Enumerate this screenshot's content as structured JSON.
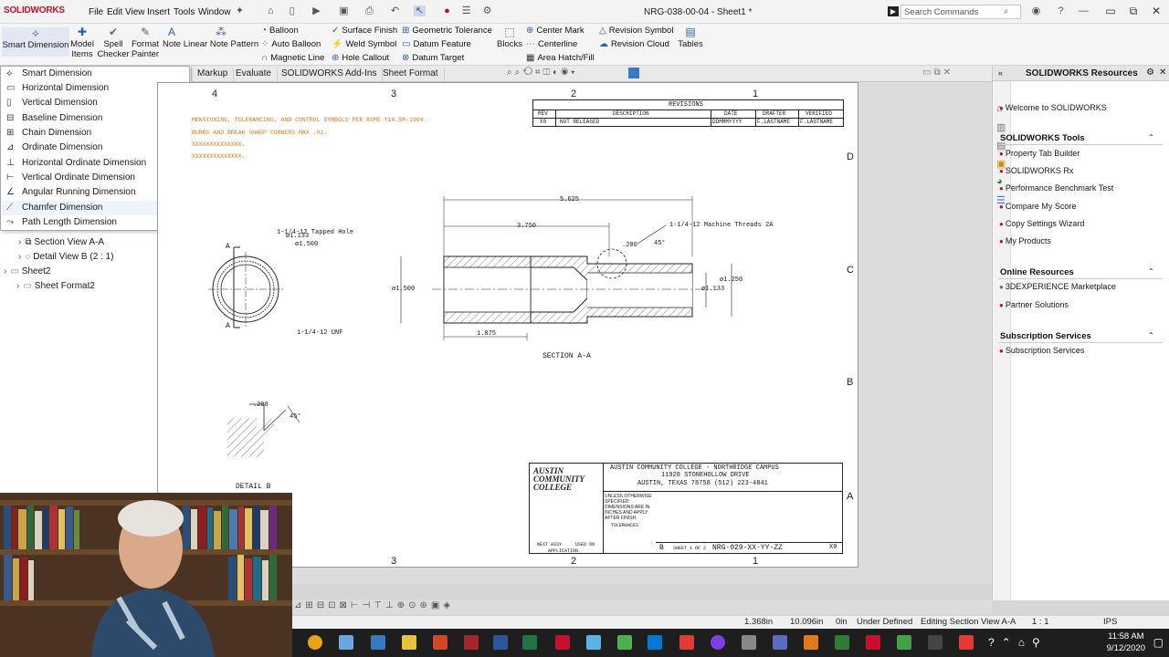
{
  "app": {
    "name": "SOLIDWORKS",
    "document": "NRG-038-00-04 - Sheet1 *",
    "search_placeholder": "Search Commands"
  },
  "menus": [
    "File",
    "Edit",
    "View",
    "Insert",
    "Tools",
    "Window"
  ],
  "toolbar": {
    "smart_dimension": "Smart Dimension",
    "model_items": [
      "Model",
      "Items"
    ],
    "spell_checker": [
      "Spell",
      "Checker"
    ],
    "format_painter": [
      "Format",
      "Painter"
    ],
    "note": "Note",
    "linear_note_pattern": "Linear Note Pattern",
    "col1": [
      "Balloon",
      "Auto Balloon",
      "Magnetic Line"
    ],
    "col2": [
      "Surface Finish",
      "Weld Symbol",
      "Hole Callout"
    ],
    "col3": [
      "Geometric Tolerance",
      "Datum Feature",
      "Datum Target"
    ],
    "blocks": "Blocks",
    "col4": [
      "Center Mark",
      "Centerline",
      "Area Hatch/Fill"
    ],
    "col5": [
      "Revision Symbol",
      "Revision Cloud"
    ],
    "tables": "Tables"
  },
  "tabs": [
    "Markup",
    "Evaluate",
    "SOLIDWORKS Add-Ins",
    "Sheet Format"
  ],
  "dimension_menu": [
    "Smart Dimension",
    "Horizontal Dimension",
    "Vertical Dimension",
    "Baseline Dimension",
    "Chain Dimension",
    "Ordinate Dimension",
    "Horizontal Ordinate Dimension",
    "Vertical Ordinate Dimension",
    "Angular Running Dimension",
    "Chamfer Dimension",
    "Path Length Dimension"
  ],
  "tree": [
    {
      "label": "Section View A-A",
      "indent": 2
    },
    {
      "label": "Detail View B (2 : 1)",
      "indent": 2
    },
    {
      "label": "Sheet2",
      "indent": 0
    },
    {
      "label": "Sheet Format2",
      "indent": 1
    }
  ],
  "drawing": {
    "zones_top": [
      "4",
      "3",
      "2",
      "1"
    ],
    "zones_side": [
      "D",
      "C",
      "B",
      "A"
    ],
    "notes": [
      "MENSIONING, TOLERANCING, AND CONTROL SYMBOLS PER ASME Y14.5M-1994.",
      "BURRS AND BREAK SHARP CORNERS MAX .02.",
      "XXXXXXXXXXXXXX.",
      "XXXXXXXXXXXXXX."
    ],
    "revisions": {
      "title": "REVISIONS",
      "headers": [
        "REV",
        "DESCRIPTION",
        "DATE",
        "DRAFTER",
        "VERIFIED"
      ],
      "row": [
        "X0",
        "NOT RELEASED",
        "DDMMMYYYY",
        "F.LASTNAME",
        "F.LASTNAME"
      ]
    },
    "dims": {
      "overall_length": "5.625",
      "len_3750": "3.750",
      "len_1875": "1.875",
      "dia_1500": "ø1.500",
      "dia_1250": "ø1.250",
      "dia_1133": "ø1.133",
      "dim_206": ".206",
      "angle": "45°",
      "machine_threads": "1-1/4-12 Machine Threads 2A",
      "tapped_hole": "1-1/4-12 Tapped Hole",
      "end_dia_1133": "ø1.133",
      "end_dia_1500": "ø1.500",
      "unf": "1-1/4-12 UNF",
      "detail_dim": ".208",
      "detail_angle": "45°"
    },
    "section_label": "SECTION  A-A",
    "detail_label": "DETAIL B",
    "section_letter": "A",
    "title_block": {
      "school": "AUSTIN COMMUNITY COLLEGE - NORTHRIDGE CAMPUS",
      "address1": "11928 STONEHOLLOW DRIVE",
      "address2": "AUSTIN, TEXAS  78758  (512) 223-4841",
      "logo": [
        "AUSTIN",
        "COMMUNITY",
        "COLLEGE"
      ],
      "unless": [
        "UNLESS OTHERWISE",
        "SPECIFIED:",
        "DIMENSIONS ARE IN",
        "INCHES AND APPLY",
        "AFTER FINISH."
      ],
      "tolerances": "TOLERANCES",
      "next_assy": "NEXT ASSY",
      "used_on": "USED ON",
      "application": "APPLICATION",
      "size": "B",
      "sheet": "SHEET 1 OF 2",
      "dwg_no": "NRG-029-XX-YY-ZZ",
      "rev": "X0"
    }
  },
  "resources": {
    "title": "SOLIDWORKS Resources",
    "welcome": "Welcome to SOLIDWORKS",
    "tools_header": "SOLIDWORKS Tools",
    "tools": [
      "Property Tab Builder",
      "SOLIDWORKS Rx",
      "Performance Benchmark Test",
      "Compare My Score",
      "Copy Settings Wizard",
      "My Products"
    ],
    "online_header": "Online Resources",
    "online": [
      "3DEXPERIENCE Marketplace",
      "Partner Solutions"
    ],
    "subs_header": "Subscription Services",
    "subs": [
      "Subscription Services"
    ]
  },
  "status": {
    "x": "1.368in",
    "y": "10.096in",
    "z": "0in",
    "state": "Under Defined",
    "editing": "Editing Section View A-A",
    "scale": "1 : 1",
    "units": "IPS"
  },
  "clock": {
    "time": "11:58 AM",
    "date": "9/12/2020"
  },
  "colors": {
    "accent": "#c8102e",
    "notes": "#e07a10",
    "sheet": "#ffffff"
  }
}
